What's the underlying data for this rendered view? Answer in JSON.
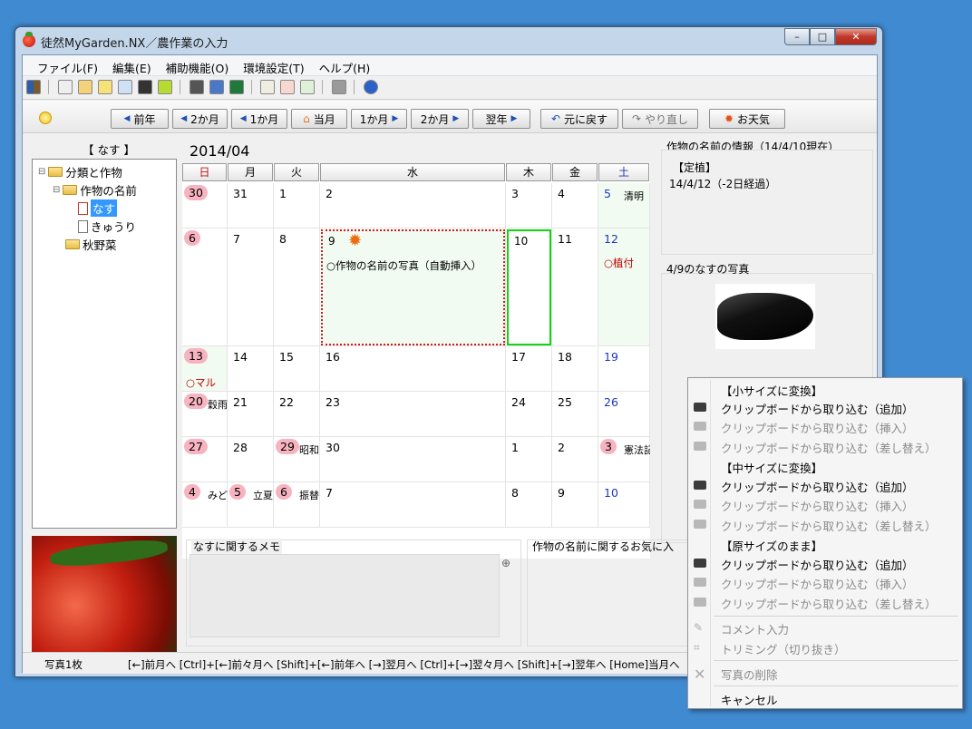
{
  "window": {
    "title": "徒然MyGarden.NX／農作業の入力",
    "min": "–",
    "max": "□",
    "close": "✕"
  },
  "menu": [
    "ファイル(F)",
    "編集(E)",
    "補助機能(O)",
    "環境設定(T)",
    "ヘルプ(H)"
  ],
  "nav": {
    "prev_year": "前年",
    "prev2": "2か月",
    "prev1": "1か月",
    "this_month": "当月",
    "next1": "1か月",
    "next2": "2か月",
    "next_year": "翌年",
    "undo": "元に戻す",
    "redo": "やり直し",
    "weather": "お天気"
  },
  "tree": {
    "header": "【 なす 】",
    "items": [
      "分類と作物",
      "作物の名前",
      "なす",
      "きゅうり",
      "秋野菜"
    ]
  },
  "calendar": {
    "month": "2014/04",
    "weekdays": [
      "日",
      "月",
      "火",
      "水",
      "木",
      "金",
      "土"
    ],
    "weeks": [
      [
        {
          "d": "30",
          "p": true
        },
        {
          "d": "31"
        },
        {
          "d": "1"
        },
        {
          "d": "2"
        },
        {
          "d": "3"
        },
        {
          "d": "4"
        },
        {
          "d": "5",
          "t": "清明"
        }
      ],
      [
        {
          "d": "6",
          "p": true
        },
        {
          "d": "7"
        },
        {
          "d": "8"
        },
        {
          "d": "9"
        },
        {
          "d": "10"
        },
        {
          "d": "11"
        },
        {
          "d": "12"
        }
      ],
      [
        {
          "d": "13",
          "p": true
        },
        {
          "d": "14"
        },
        {
          "d": "15"
        },
        {
          "d": "16"
        },
        {
          "d": "17"
        },
        {
          "d": "18"
        },
        {
          "d": "19"
        }
      ],
      [
        {
          "d": "20",
          "p": true,
          "t": "穀雨"
        },
        {
          "d": "21"
        },
        {
          "d": "22"
        },
        {
          "d": "23"
        },
        {
          "d": "24"
        },
        {
          "d": "25"
        },
        {
          "d": "26"
        }
      ],
      [
        {
          "d": "27",
          "p": true
        },
        {
          "d": "28"
        },
        {
          "d": "29",
          "p": true,
          "t": "昭和"
        },
        {
          "d": "30"
        },
        {
          "d": "1"
        },
        {
          "d": "2"
        },
        {
          "d": "3",
          "p": true,
          "t": "憲法記"
        }
      ],
      [
        {
          "d": "4",
          "p": true,
          "t": "みど"
        },
        {
          "d": "5",
          "p": true,
          "t": "立夏"
        },
        {
          "d": "6",
          "p": true,
          "t": "振替"
        },
        {
          "d": "7"
        },
        {
          "d": "8"
        },
        {
          "d": "9"
        },
        {
          "d": "10"
        }
      ]
    ],
    "events": {
      "photo": "○作物の名前の写真（自動挿入）",
      "plant": "○植付",
      "maru": "○マル"
    }
  },
  "info": {
    "title": "作物の名前の情報（14/4/10現在）",
    "tag": "【定植】",
    "date": "14/4/12（-2日経過）"
  },
  "photo": {
    "title": "4/9のなすの写真"
  },
  "memo": {
    "left_title": "なすに関するメモ",
    "right_title": "作物の名前に関するお気に入"
  },
  "status": {
    "count": "写真1枚",
    "keys": "[←]前月へ [Ctrl]+[←]前々月へ [Shift]+[←]前年へ [→]翌月へ [Ctrl]+[→]翌々月へ [Shift]+[→]翌年へ [Home]当月へ"
  },
  "context_menu": {
    "small": "【小サイズに変換】",
    "medium": "【中サイズに変換】",
    "original": "【原サイズのまま】",
    "add": "クリップボードから取り込む（追加）",
    "insert": "クリップボードから取り込む（挿入）",
    "replace": "クリップボードから取り込む（差し替え）",
    "comment": "コメント入力",
    "trim": "トリミング（切り抜き）",
    "delete": "写真の削除",
    "cancel": "キャンセル"
  }
}
